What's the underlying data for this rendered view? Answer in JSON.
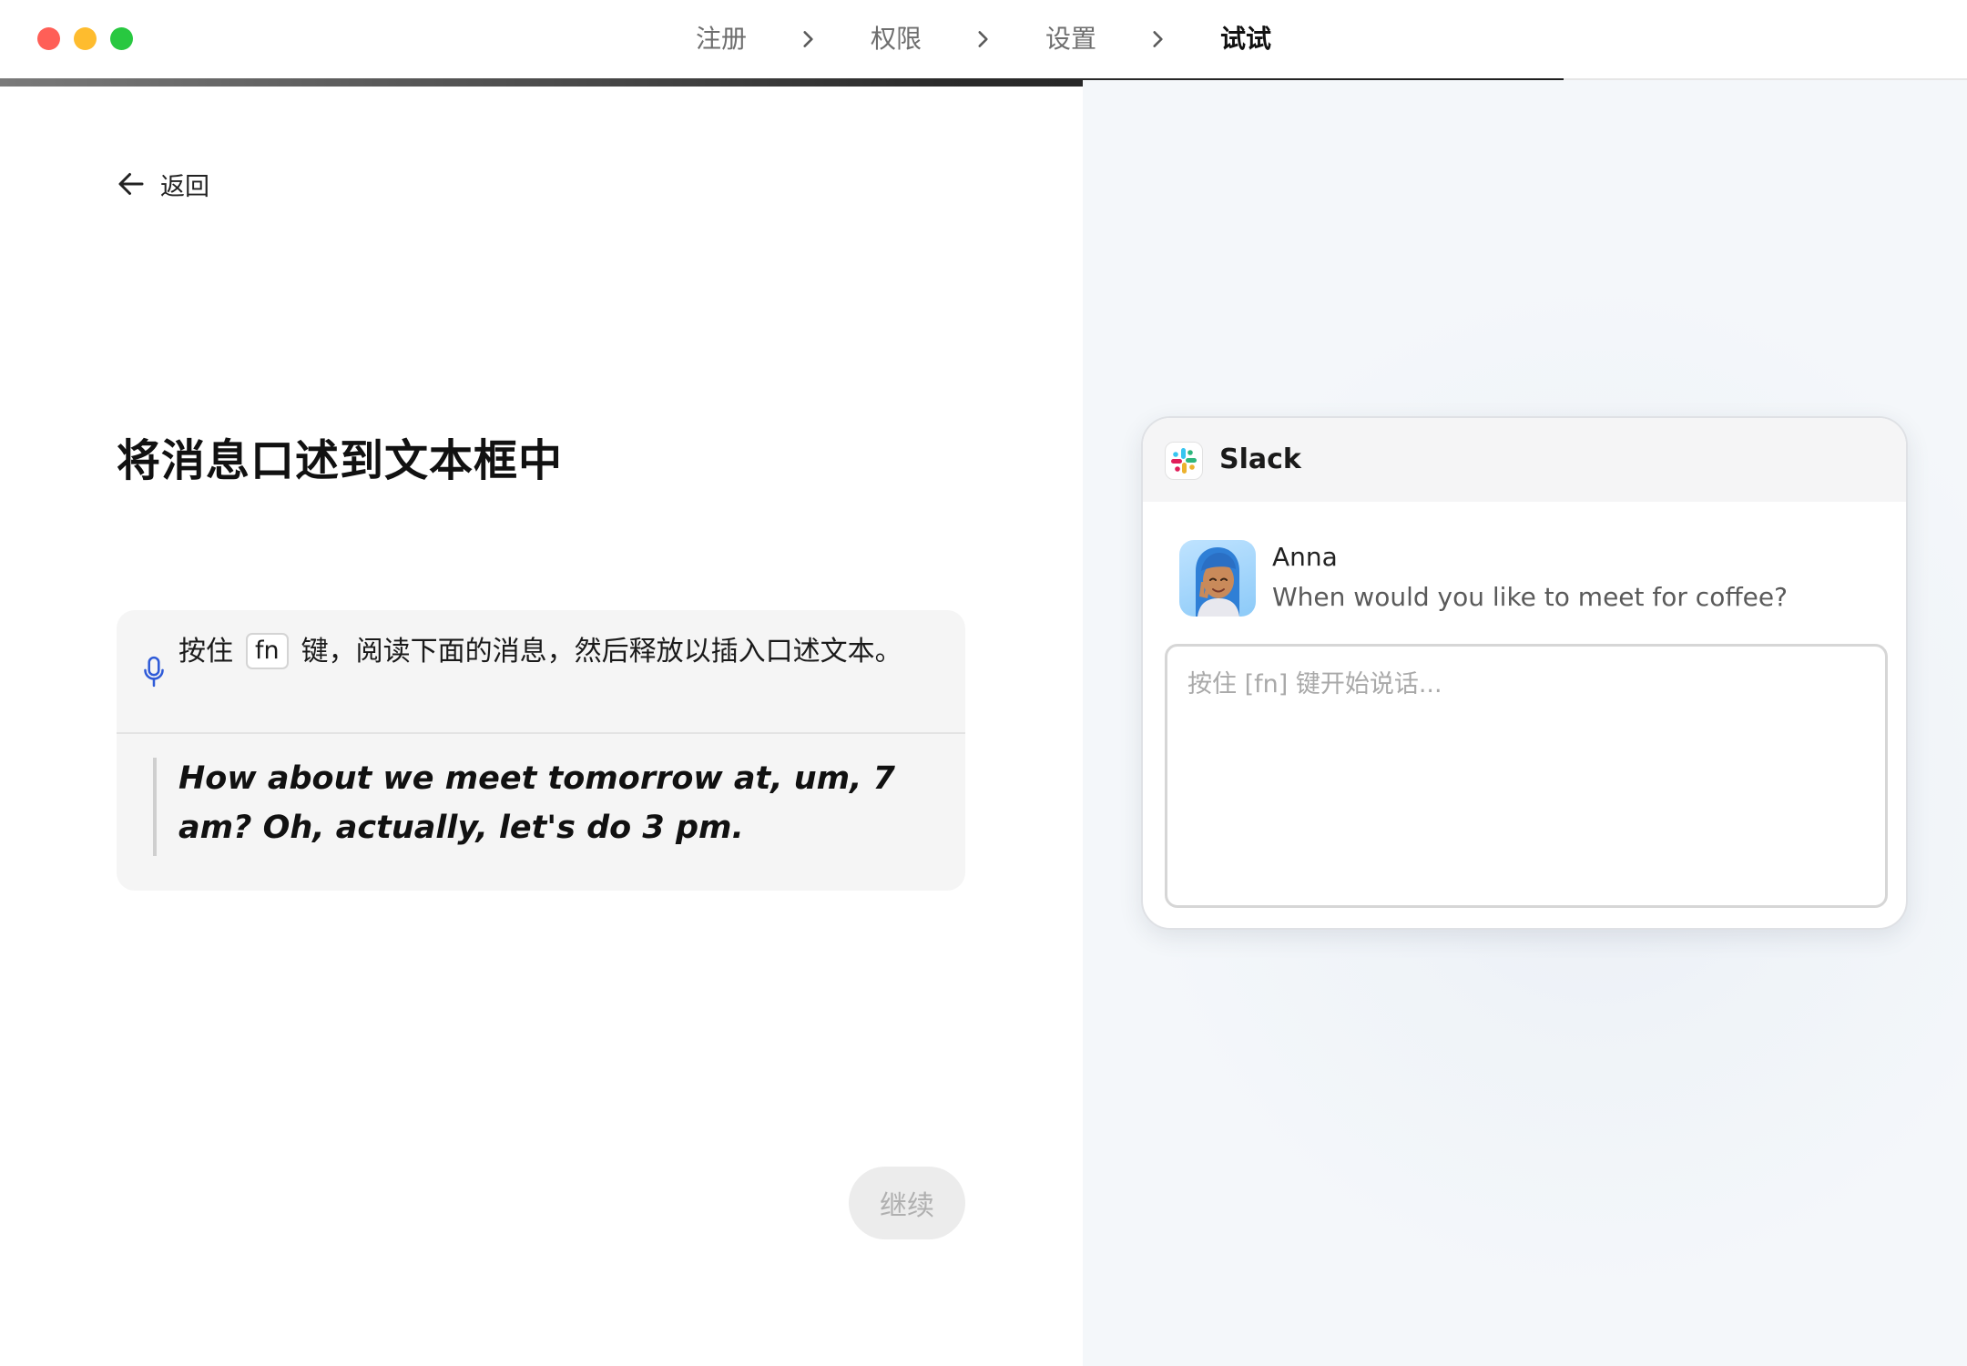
{
  "window": {
    "controls": [
      "close",
      "minimize",
      "maximize"
    ]
  },
  "steps": {
    "items": [
      {
        "label": "注册",
        "active": false
      },
      {
        "label": "权限",
        "active": false
      },
      {
        "label": "设置",
        "active": false
      },
      {
        "label": "试试",
        "active": true
      }
    ],
    "separator_icon": "chevron-right-icon"
  },
  "progress": {
    "fraction": 0.795
  },
  "nav": {
    "back_label": "返回",
    "back_icon": "arrow-left-icon"
  },
  "main": {
    "heading": "将消息口述到文本框中",
    "instruction": {
      "icon": "microphone-icon",
      "prefix": "按住",
      "key": "fn",
      "suffix": "键，阅读下面的消息，然后释放以插入口述文本。"
    },
    "quote": "How about we meet tomorrow at, um, 7 am? Oh, actually, let's do 3 pm.",
    "continue_label": "继续"
  },
  "slack": {
    "app_name": "Slack",
    "sender": "Anna",
    "message": "When would you like to meet for coffee?",
    "reply_placeholder": "按住 [fn] 键开始说话..."
  },
  "colors": {
    "close": "#ff5f57",
    "minimize": "#febc2e",
    "maximize": "#28c840",
    "mic_accent": "#2f5bd8",
    "continue_disabled_bg": "#ececec",
    "continue_disabled_text": "#b0b0b0"
  }
}
